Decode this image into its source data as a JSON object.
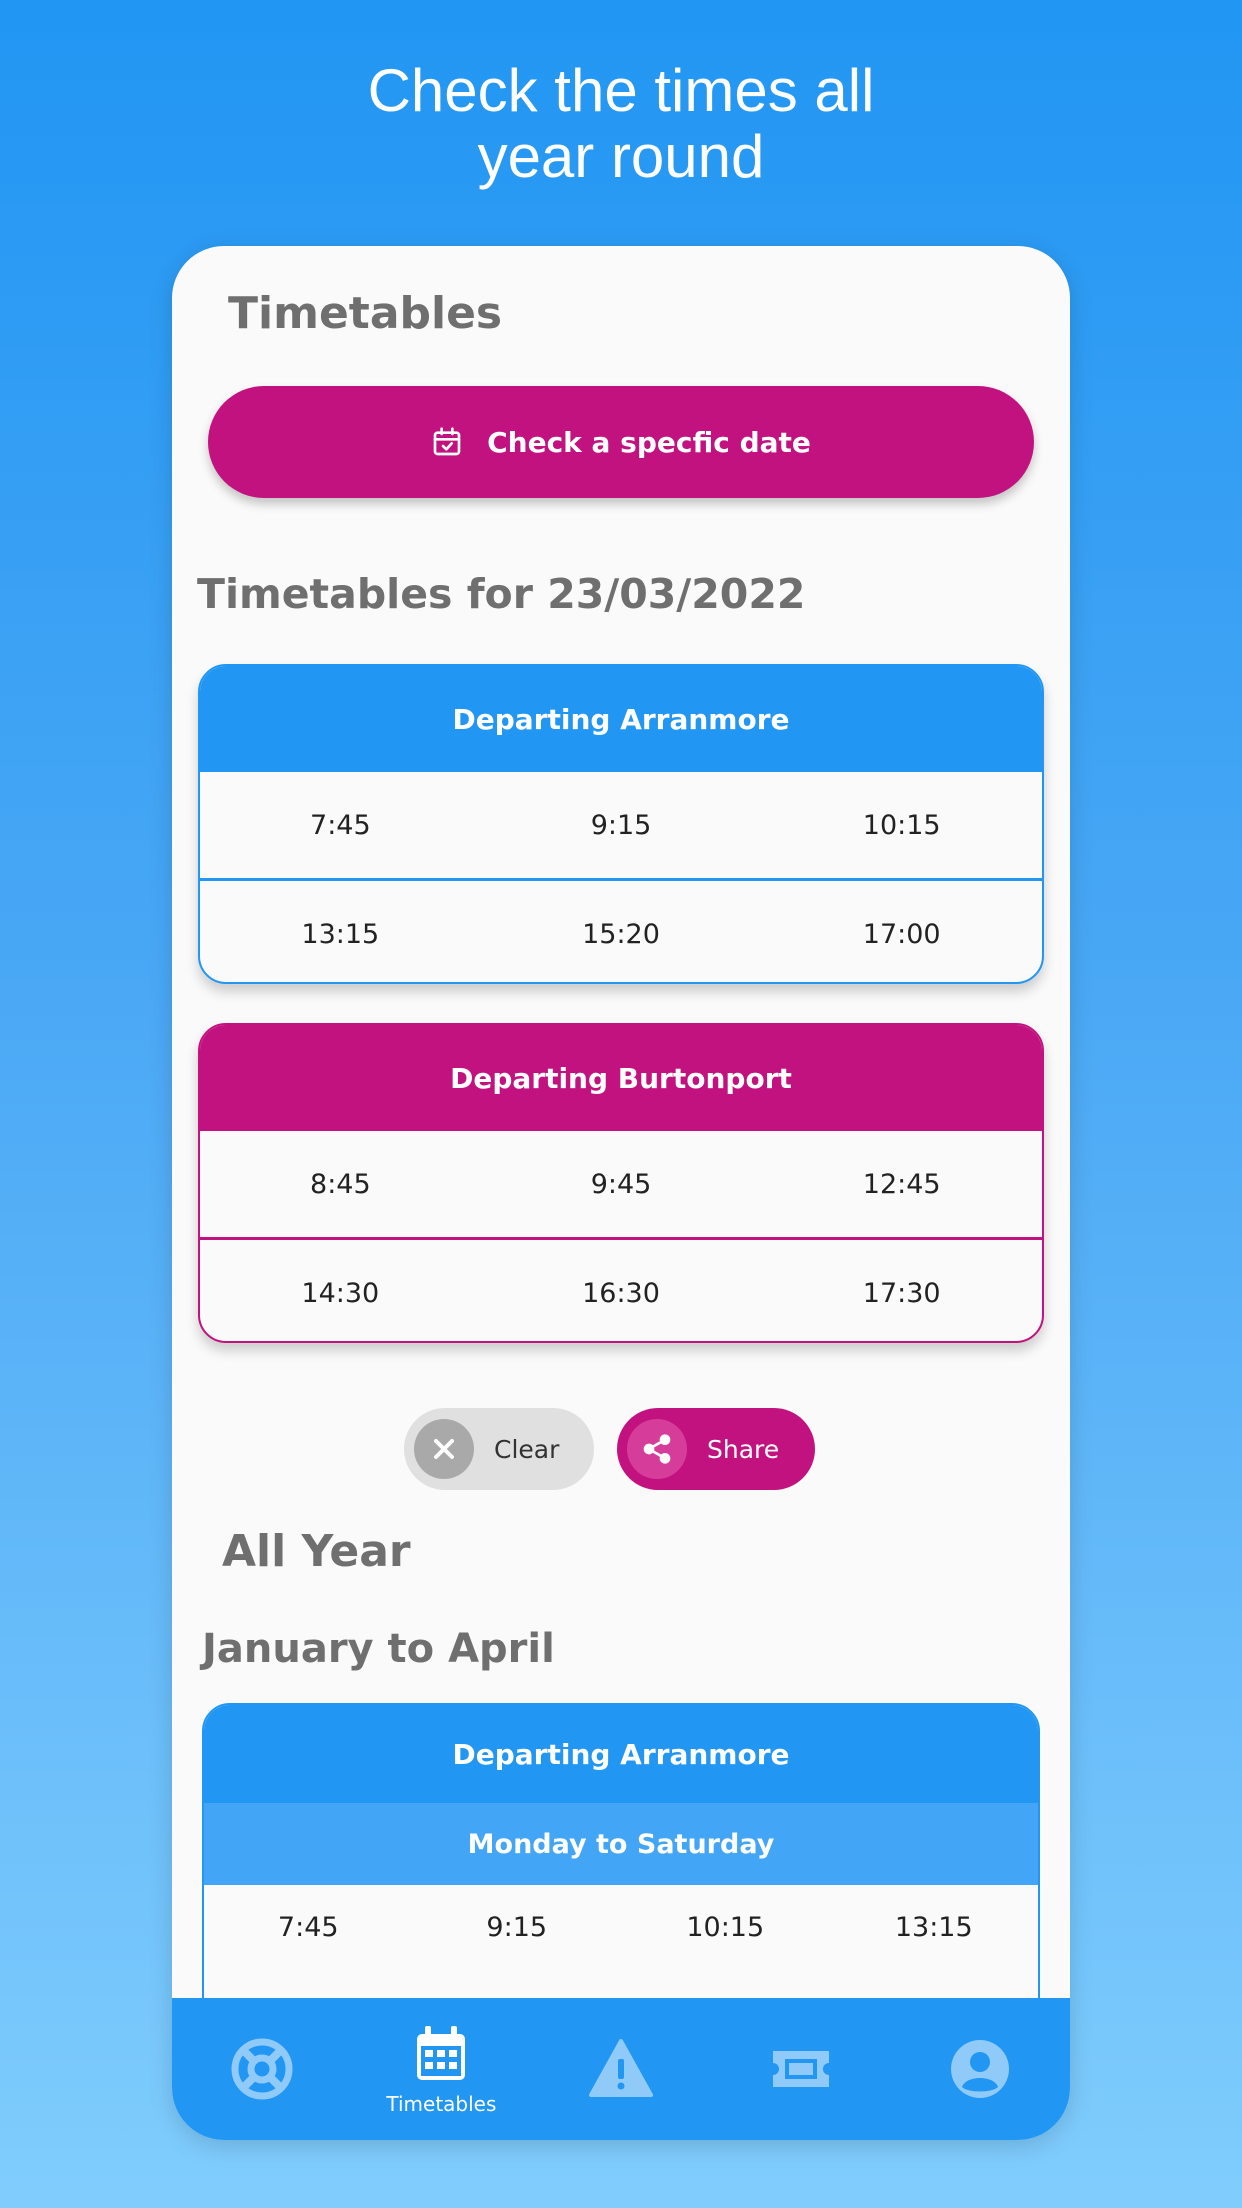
{
  "headline": {
    "line1": "Check the times all",
    "line2": "year round"
  },
  "page_title": "Timetables",
  "date_button": {
    "label": "Check a specfic date",
    "icon": "calendar-check-icon"
  },
  "date_section_title": "Timetables for 23/03/2022",
  "arranmore": {
    "title": "Departing Arranmore",
    "rows": [
      [
        "7:45",
        "9:15",
        "10:15"
      ],
      [
        "13:15",
        "15:20",
        "17:00"
      ]
    ]
  },
  "burtonport": {
    "title": "Departing Burtonport",
    "rows": [
      [
        "8:45",
        "9:45",
        "12:45"
      ],
      [
        "14:30",
        "16:30",
        "17:30"
      ]
    ]
  },
  "actions": {
    "clear_label": "Clear",
    "share_label": "Share"
  },
  "all_year_title": "All Year",
  "season_title": "January to April",
  "season_table": {
    "title": "Departing Arranmore",
    "subtitle": "Monday to Saturday",
    "row": [
      "7:45",
      "9:15",
      "10:15",
      "13:15"
    ]
  },
  "nav": {
    "items": [
      {
        "icon": "lifebuoy-icon",
        "label": ""
      },
      {
        "icon": "calendar-icon",
        "label": "Timetables"
      },
      {
        "icon": "warning-icon",
        "label": ""
      },
      {
        "icon": "ticket-icon",
        "label": ""
      },
      {
        "icon": "account-icon",
        "label": ""
      }
    ]
  },
  "colors": {
    "blue": "#2196f3",
    "pink": "#c2127f",
    "nav_inactive": "#90caf9"
  }
}
